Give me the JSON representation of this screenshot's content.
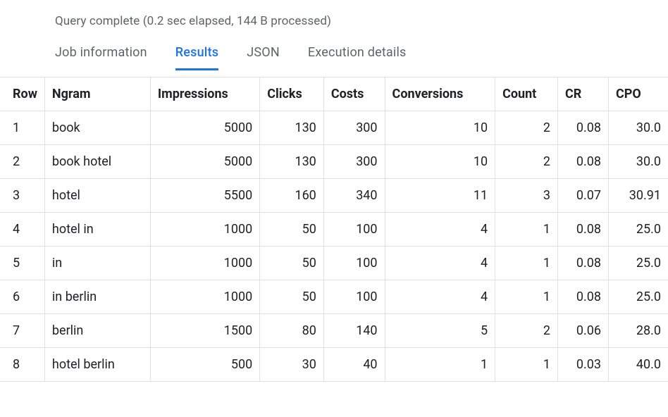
{
  "status": "Query complete (0.2 sec elapsed, 144 B processed)",
  "tabs": [
    {
      "label": "Job information",
      "active": false
    },
    {
      "label": "Results",
      "active": true
    },
    {
      "label": "JSON",
      "active": false
    },
    {
      "label": "Execution details",
      "active": false
    }
  ],
  "table": {
    "headers": [
      "Row",
      "Ngram",
      "Impressions",
      "Clicks",
      "Costs",
      "Conversions",
      "Count",
      "CR",
      "CPO"
    ],
    "header_align": [
      "left",
      "left",
      "left",
      "left",
      "left",
      "left",
      "left",
      "left",
      "left"
    ],
    "col_align": [
      "left",
      "left",
      "right",
      "right",
      "right",
      "right",
      "right",
      "right",
      "right"
    ],
    "rows": [
      [
        "1",
        "book",
        "5000",
        "130",
        "300",
        "10",
        "2",
        "0.08",
        "30.0"
      ],
      [
        "2",
        "book hotel",
        "5000",
        "130",
        "300",
        "10",
        "2",
        "0.08",
        "30.0"
      ],
      [
        "3",
        "hotel",
        "5500",
        "160",
        "340",
        "11",
        "3",
        "0.07",
        "30.91"
      ],
      [
        "4",
        "hotel in",
        "1000",
        "50",
        "100",
        "4",
        "1",
        "0.08",
        "25.0"
      ],
      [
        "5",
        "in",
        "1000",
        "50",
        "100",
        "4",
        "1",
        "0.08",
        "25.0"
      ],
      [
        "6",
        "in berlin",
        "1000",
        "50",
        "100",
        "4",
        "1",
        "0.08",
        "25.0"
      ],
      [
        "7",
        "berlin",
        "1500",
        "80",
        "140",
        "5",
        "2",
        "0.06",
        "28.0"
      ],
      [
        "8",
        "hotel berlin",
        "500",
        "30",
        "40",
        "1",
        "1",
        "0.03",
        "40.0"
      ]
    ]
  }
}
